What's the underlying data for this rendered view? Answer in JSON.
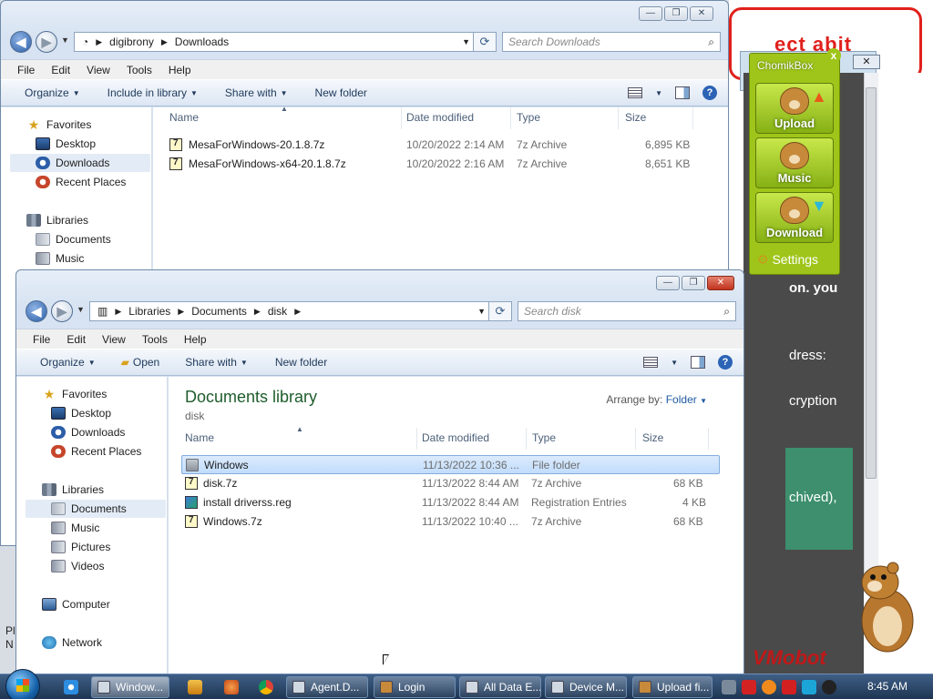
{
  "background": {
    "banner_text": "ect abit",
    "text_lines": [
      "on. you",
      "dress:",
      "cryption",
      "chived),"
    ],
    "logo_text": "VMobot",
    "close_glyph": "✕"
  },
  "chomikbox": {
    "title": "ChomikBox",
    "close": "x",
    "buttons": [
      "Upload",
      "Music",
      "Download"
    ],
    "settings": "Settings"
  },
  "window1": {
    "caption_buttons": [
      "—",
      "❐",
      "✕"
    ],
    "address": [
      "digibrony",
      "Downloads"
    ],
    "search_placeholder": "Search Downloads",
    "menu": [
      "File",
      "Edit",
      "View",
      "Tools",
      "Help"
    ],
    "toolbar": [
      "Organize",
      "Include in library",
      "Share with",
      "New folder"
    ],
    "nav": {
      "favorites": "Favorites",
      "favorite_items": [
        "Desktop",
        "Downloads",
        "Recent Places"
      ],
      "libraries": "Libraries",
      "library_items": [
        "Documents",
        "Music"
      ]
    },
    "columns": [
      "Name",
      "Date modified",
      "Type",
      "Size"
    ],
    "files": [
      {
        "name": "MesaForWindows-20.1.8.7z",
        "date": "10/20/2022 2:14 AM",
        "type": "7z Archive",
        "size": "6,895 KB"
      },
      {
        "name": "MesaForWindows-x64-20.1.8.7z",
        "date": "10/20/2022 2:16 AM",
        "type": "7z Archive",
        "size": "8,651 KB"
      }
    ]
  },
  "window2": {
    "caption_buttons": [
      "—",
      "❐",
      "✕"
    ],
    "address": [
      "Libraries",
      "Documents",
      "disk"
    ],
    "search_placeholder": "Search disk",
    "menu": [
      "File",
      "Edit",
      "View",
      "Tools",
      "Help"
    ],
    "toolbar": [
      "Organize",
      "Open",
      "Share with",
      "New folder"
    ],
    "library_title": "Documents library",
    "library_subtitle": "disk",
    "arrange_label": "Arrange by:",
    "arrange_value": "Folder",
    "nav": {
      "favorites": "Favorites",
      "favorite_items": [
        "Desktop",
        "Downloads",
        "Recent Places"
      ],
      "libraries": "Libraries",
      "library_items": [
        "Documents",
        "Music",
        "Pictures",
        "Videos"
      ],
      "computer": "Computer",
      "network": "Network"
    },
    "columns": [
      "Name",
      "Date modified",
      "Type",
      "Size"
    ],
    "files": [
      {
        "name": "Windows",
        "date": "11/13/2022 10:36 ...",
        "type": "File folder",
        "size": ""
      },
      {
        "name": "disk.7z",
        "date": "11/13/2022 8:44 AM",
        "type": "7z Archive",
        "size": "68 KB"
      },
      {
        "name": "install driverss.reg",
        "date": "11/13/2022 8:44 AM",
        "type": "Registration Entries",
        "size": "4 KB"
      },
      {
        "name": "Windows.7z",
        "date": "11/13/2022 10:40 ...",
        "type": "7z Archive",
        "size": "68 KB"
      }
    ]
  },
  "taskbar": {
    "buttons": [
      "Window...",
      "Agent.D...",
      "Login",
      "All Data E...",
      "Device M...",
      "Upload fi..."
    ],
    "clock": "8:45 AM"
  },
  "left_edge": [
    "Pl",
    "N"
  ]
}
